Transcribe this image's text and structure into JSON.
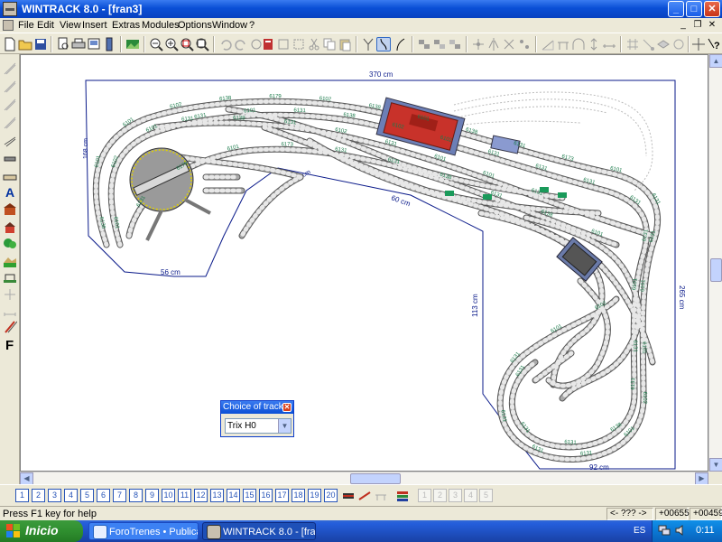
{
  "window": {
    "title": "WINTRACK 8.0 - [fran3]",
    "minimize": "_",
    "maximize": "□",
    "close": "✕"
  },
  "menu": {
    "items": [
      "File",
      "Edit",
      "View",
      "Insert",
      "Extras",
      "Modules",
      "Options",
      "Window",
      "?"
    ],
    "mdi_minimize": "_",
    "mdi_restore": "❐",
    "mdi_close": "✕"
  },
  "canvas": {
    "dimensions": [
      "370 cm",
      "265 cm",
      "113 cm",
      "92 cm",
      "56 cm",
      "60 cm",
      "16 cm",
      "168 cm"
    ],
    "track_labels": [
      "6138",
      "6101",
      "6101",
      "6102",
      "6138",
      "6179",
      "6102",
      "6138",
      "6101",
      "6138",
      "6131",
      "6173",
      "6101",
      "6131",
      "6131",
      "6101",
      "6101",
      "6102",
      "6101",
      "6131",
      "6131",
      "6131",
      "6131",
      "6101",
      "6102",
      "6101",
      "6102",
      "6101",
      "6131",
      "6101",
      "6131",
      "6138",
      "6102",
      "6102",
      "6131",
      "6131",
      "6131",
      "6131",
      "6131",
      "6101",
      "6131",
      "6131",
      "6138",
      "6131",
      "6131",
      "6131",
      "6131",
      "6179",
      "6101",
      "6173",
      "6131",
      "6131",
      "6138",
      "6131",
      "6138",
      "6101",
      "6131",
      "6138",
      "6131",
      "6102",
      "6131",
      "6101",
      "6101",
      "6131"
    ],
    "accent_track_fill": "#a9a9a9",
    "label_color": "#1a7a4a",
    "dimension_color": "#00008b"
  },
  "palette": {
    "title": "Choice of track",
    "close": "✕",
    "selected": "Trix H0",
    "drop": "▼"
  },
  "layers": {
    "numbers": [
      "1",
      "2",
      "3",
      "4",
      "5",
      "6",
      "7",
      "8",
      "9",
      "10",
      "11",
      "12",
      "13",
      "14",
      "15",
      "16",
      "17",
      "18",
      "19",
      "20"
    ],
    "extra": [
      "1",
      "2",
      "3",
      "4",
      "5"
    ]
  },
  "status": {
    "help": "Press F1 key for help",
    "info": "<- ??? ->",
    "x": "+00655",
    "y": "+00459"
  },
  "taskbar": {
    "start": "Inicio",
    "tasks": [
      "ForoTrenes • Publicar...",
      "WINTRACK 8.0 - [fra..."
    ],
    "lang": "ES",
    "clock": "0:11"
  },
  "scroll": {
    "up": "▲",
    "down": "▼",
    "left": "◀",
    "right": "▶"
  }
}
